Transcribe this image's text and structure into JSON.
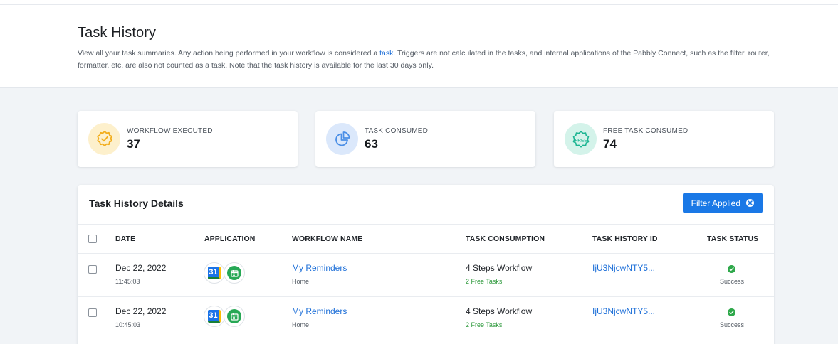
{
  "header": {
    "title": "Task History",
    "desc_before": "View all your task summaries. Any action being performed in your workflow is considered a ",
    "desc_link": "task",
    "desc_after": ". Triggers are not calculated in the tasks, and internal applications of the Pabbly Connect, such as the filter, router, formatter, etc, are also not counted as a task. Note that the task history is available for the last 30 days only."
  },
  "stats": [
    {
      "label": "WORKFLOW EXECUTED",
      "value": "37",
      "icon": "badge-check-icon",
      "bg": "#fdf0cc",
      "color": "#f2ad1c"
    },
    {
      "label": "TASK CONSUMED",
      "value": "63",
      "icon": "pie-chart-icon",
      "bg": "#dbe8fb",
      "color": "#4a8ee6"
    },
    {
      "label": "FREE TASK CONSUMED",
      "value": "74",
      "icon": "free-badge-icon",
      "bg": "#d4f3ea",
      "color": "#1cb592"
    }
  ],
  "panel": {
    "title": "Task History Details",
    "filter_label": "Filter Applied"
  },
  "columns": {
    "date": "DATE",
    "application": "APPLICATION",
    "workflow_name": "WORKFLOW NAME",
    "task_consumption": "TASK CONSUMPTION",
    "task_history_id": "TASK HISTORY ID",
    "task_status": "TASK STATUS"
  },
  "rows": [
    {
      "date": "Dec 22, 2022",
      "time": "11:45:03",
      "app1": "31",
      "workflow": "My Reminders",
      "folder": "Home",
      "consumption": "4 Steps Workflow",
      "free": "2 Free Tasks",
      "history_id": "IjU3NjcwNTY5...",
      "status": "Success"
    },
    {
      "date": "Dec 22, 2022",
      "time": "10:45:03",
      "app1": "31",
      "workflow": "My Reminders",
      "folder": "Home",
      "consumption": "4 Steps Workflow",
      "free": "2 Free Tasks",
      "history_id": "IjU3NjcwNTY5...",
      "status": "Success"
    }
  ]
}
